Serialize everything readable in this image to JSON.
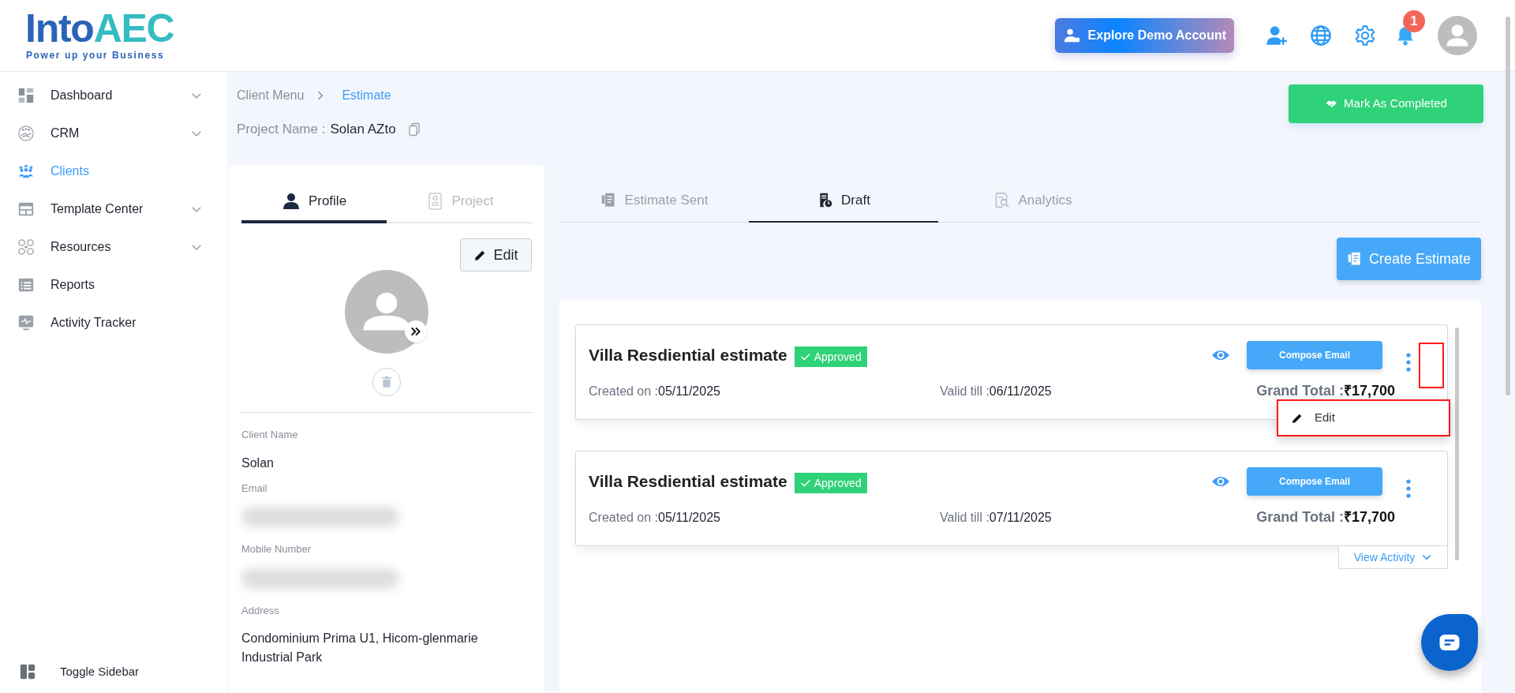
{
  "header": {
    "logo": {
      "word_1": "Into",
      "word_2": "AEC",
      "tagline": "Power up your Business"
    },
    "demo_button": "Explore Demo Account",
    "notification_count": "1"
  },
  "sidebar": {
    "items": [
      {
        "label": "Dashboard",
        "kind": "dashboard",
        "expandable": true,
        "selected": false
      },
      {
        "label": "CRM",
        "kind": "crm",
        "expandable": true,
        "selected": false
      },
      {
        "label": "Clients",
        "kind": "clients",
        "expandable": false,
        "selected": true
      },
      {
        "label": "Template Center",
        "kind": "template",
        "expandable": true,
        "selected": false
      },
      {
        "label": "Resources",
        "kind": "resources",
        "expandable": true,
        "selected": false
      },
      {
        "label": "Reports",
        "kind": "reports",
        "expandable": false,
        "selected": false
      },
      {
        "label": "Activity Tracker",
        "kind": "activity",
        "expandable": false,
        "selected": false
      }
    ],
    "toggle": "Toggle Sidebar"
  },
  "breadcrumb": [
    {
      "label": "Client Menu",
      "current": false
    },
    {
      "label": "Estimate",
      "current": true
    }
  ],
  "project": {
    "label": "Project Name :",
    "value": "Solan AZto"
  },
  "mark_completed_button": "Mark As Completed",
  "profile_panel": {
    "tabs": [
      {
        "label": "Profile",
        "kind": "person",
        "selected": true
      },
      {
        "label": "Project",
        "kind": "doc",
        "selected": false
      }
    ],
    "edit_button": "Edit",
    "fields": [
      {
        "label": "Client Name",
        "kind": "text",
        "value": "Solan"
      },
      {
        "label": "Email",
        "kind": "blurred"
      },
      {
        "label": "Mobile Number",
        "kind": "blurred"
      },
      {
        "label": "Address",
        "kind": "text",
        "value": "Condominium Prima U1, Hicom-glenmarie Industrial Park"
      }
    ]
  },
  "estimate_tabs": [
    {
      "label": "Estimate Sent",
      "kind": "receipt",
      "selected": false
    },
    {
      "label": "Draft",
      "kind": "draft",
      "selected": true
    },
    {
      "label": "Analytics",
      "kind": "analytics",
      "selected": false
    }
  ],
  "create_button": "Create Estimate",
  "estimates": [
    {
      "title": "Villa Resdiential estimate",
      "status": "Approved",
      "action": "Compose Email",
      "created_label": "Created on :",
      "created": "05/11/2025",
      "valid_label": "Valid till :",
      "valid": "06/11/2025",
      "total_label": "Grand Total :",
      "total": "₹17,700",
      "menu_open": true,
      "menu": [
        "Edit"
      ]
    },
    {
      "title": "Villa Resdiential estimate",
      "status": "Approved",
      "action": "Compose Email",
      "created_label": "Created on :",
      "created": "05/11/2025",
      "valid_label": "Valid till :",
      "valid": "07/11/2025",
      "total_label": "Grand Total :",
      "total": "₹17,700",
      "menu_open": false,
      "activity_link": "View Activity"
    }
  ]
}
